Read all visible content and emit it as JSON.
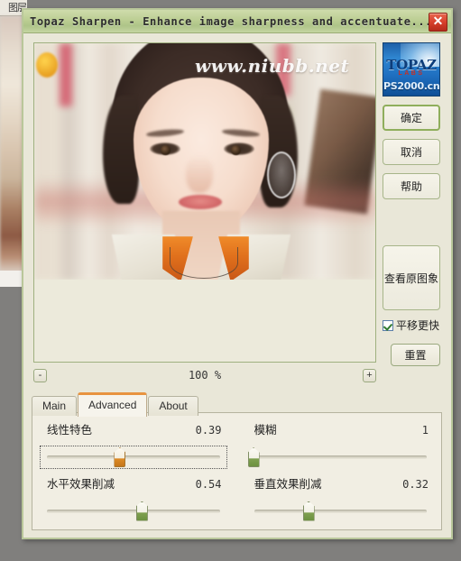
{
  "background_app": {
    "panel_tab_label": "图层"
  },
  "dialog": {
    "title": "Topaz Sharpen - Enhance image sharpness and accentuate...",
    "close_label": "✕"
  },
  "preview": {
    "watermark": "www.niubb.net",
    "zoom": {
      "minus_label": "-",
      "plus_label": "+",
      "value": "100 %"
    }
  },
  "tabs": [
    {
      "label": "Main",
      "active": false
    },
    {
      "label": "Advanced",
      "active": true
    },
    {
      "label": "About",
      "active": false
    }
  ],
  "sliders": [
    {
      "label": "线性特色",
      "value": "0.39",
      "percent": 42,
      "thumb_color": "#dd8a25",
      "focused": true
    },
    {
      "label": "模糊",
      "value": "1",
      "percent": 2,
      "thumb_color": "#7fa04f",
      "focused": false
    },
    {
      "label": "水平效果削减",
      "value": "0.54",
      "percent": 54,
      "thumb_color": "#7fa04f",
      "focused": false
    },
    {
      "label": "垂直效果削减",
      "value": "0.32",
      "percent": 32,
      "thumb_color": "#7fa04f",
      "focused": false
    }
  ],
  "logo": {
    "brand": "TOPAZ",
    "sub": "LABS",
    "site": "PS2000.cn"
  },
  "actions": {
    "ok": "确定",
    "cancel": "取消",
    "help": "帮助",
    "view_original": "查看原图象",
    "pan_faster": "平移更快",
    "reset": "重置"
  },
  "colors": {
    "titlebar": "#bcce93",
    "dialog_bg": "#e9e7d8",
    "accent_tab": "#e8933f",
    "close_red": "#d8402c"
  }
}
